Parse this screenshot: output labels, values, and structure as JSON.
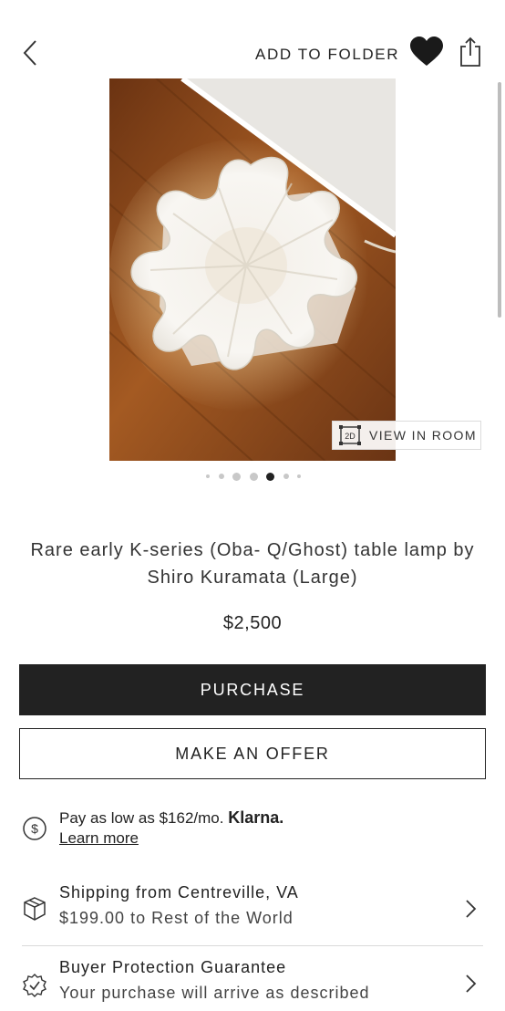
{
  "header": {
    "add_to_folder_label": "ADD TO FOLDER"
  },
  "icons": {
    "back": "chevron-left-icon",
    "favorite": "heart-icon",
    "share": "share-icon",
    "view_in_room": "2d-icon",
    "klarna": "dollar-circle-icon",
    "shipping": "package-icon",
    "protection": "check-badge-icon",
    "row_arrow": "chevron-right-icon"
  },
  "gallery": {
    "view_in_room_label": "VIEW IN ROOM",
    "view_in_room_badge": "2D",
    "dot_count": 7,
    "active_index": 4
  },
  "product": {
    "title": "Rare early K-series (Oba- Q/Ghost) table lamp by Shiro Kuramata (Large)",
    "price": "$2,500"
  },
  "actions": {
    "purchase_label": "PURCHASE",
    "offer_label": "MAKE AN OFFER"
  },
  "financing": {
    "text": "Pay as low as $162/mo.",
    "brand": "Klarna.",
    "link": "Learn more"
  },
  "shipping": {
    "title": "Shipping from Centreville, VA",
    "subtitle": "$199.00 to Rest of the World"
  },
  "protection": {
    "title": "Buyer Protection Guarantee",
    "subtitle": "Your purchase will arrive as described"
  },
  "colors": {
    "primary_button": "#222222",
    "background": "#ffffff",
    "divider": "#d9d9d9"
  }
}
